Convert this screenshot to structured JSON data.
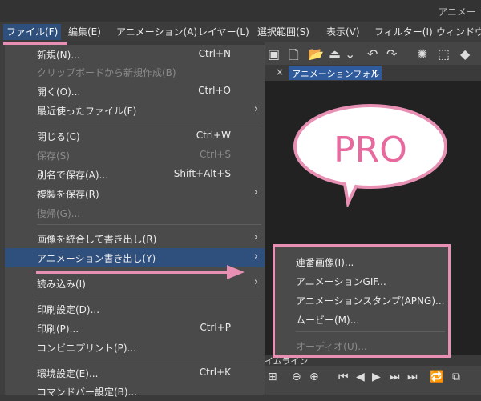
{
  "window": {
    "title": "アニメー"
  },
  "menubar": [
    {
      "label": "ファイル(F)",
      "active": true
    },
    {
      "label": "編集(E)"
    },
    {
      "label": "アニメーション(A)"
    },
    {
      "label": "レイヤー(L)"
    },
    {
      "label": "選択範囲(S)"
    },
    {
      "label": "表示(V)"
    },
    {
      "label": "フィルター(I)"
    },
    {
      "label": "ウィンドウ(W"
    }
  ],
  "tab": {
    "label": "アニメーションフォルダ",
    "close": "×"
  },
  "file_menu": [
    {
      "label": "新規(N)...",
      "shortcut": "Ctrl+N"
    },
    {
      "label": "クリップボードから新規作成(B)",
      "disabled": true
    },
    {
      "label": "開く(O)...",
      "shortcut": "Ctrl+O"
    },
    {
      "label": "最近使ったファイル(F)",
      "submenu": true
    },
    {
      "label": "閉じる(C)",
      "shortcut": "Ctrl+W"
    },
    {
      "label": "保存(S)",
      "shortcut": "Ctrl+S",
      "disabled": true
    },
    {
      "label": "別名で保存(A)...",
      "shortcut": "Shift+Alt+S"
    },
    {
      "label": "複製を保存(R)",
      "submenu": true
    },
    {
      "label": "復帰(G)...",
      "disabled": true
    },
    {
      "label": "画像を統合して書き出し(R)",
      "submenu": true
    },
    {
      "label": "アニメーション書き出し(Y)",
      "submenu": true,
      "highlighted": true
    },
    {
      "label": "読み込み(I)",
      "submenu": true
    },
    {
      "label": "印刷設定(D)..."
    },
    {
      "label": "印刷(P)...",
      "shortcut": "Ctrl+P"
    },
    {
      "label": "コンビニプリント(P)..."
    },
    {
      "label": "環境設定(E)...",
      "shortcut": "Ctrl+K"
    },
    {
      "label": "コマンドバー設定(B)..."
    }
  ],
  "export_submenu": [
    {
      "label": "連番画像(I)..."
    },
    {
      "label": "アニメーションGIF..."
    },
    {
      "label": "アニメーションスタンプ(APNG)..."
    },
    {
      "label": "ムービー(M)..."
    },
    {
      "label": "オーディオ(U)...",
      "disabled": true
    }
  ],
  "bubble": {
    "text": "PRO"
  },
  "timeline": {
    "label": "イムライン"
  },
  "colors": {
    "accent_pink": "#e88fb4",
    "menu_bg": "#4a4a4a",
    "highlight": "#2f4f7c"
  }
}
